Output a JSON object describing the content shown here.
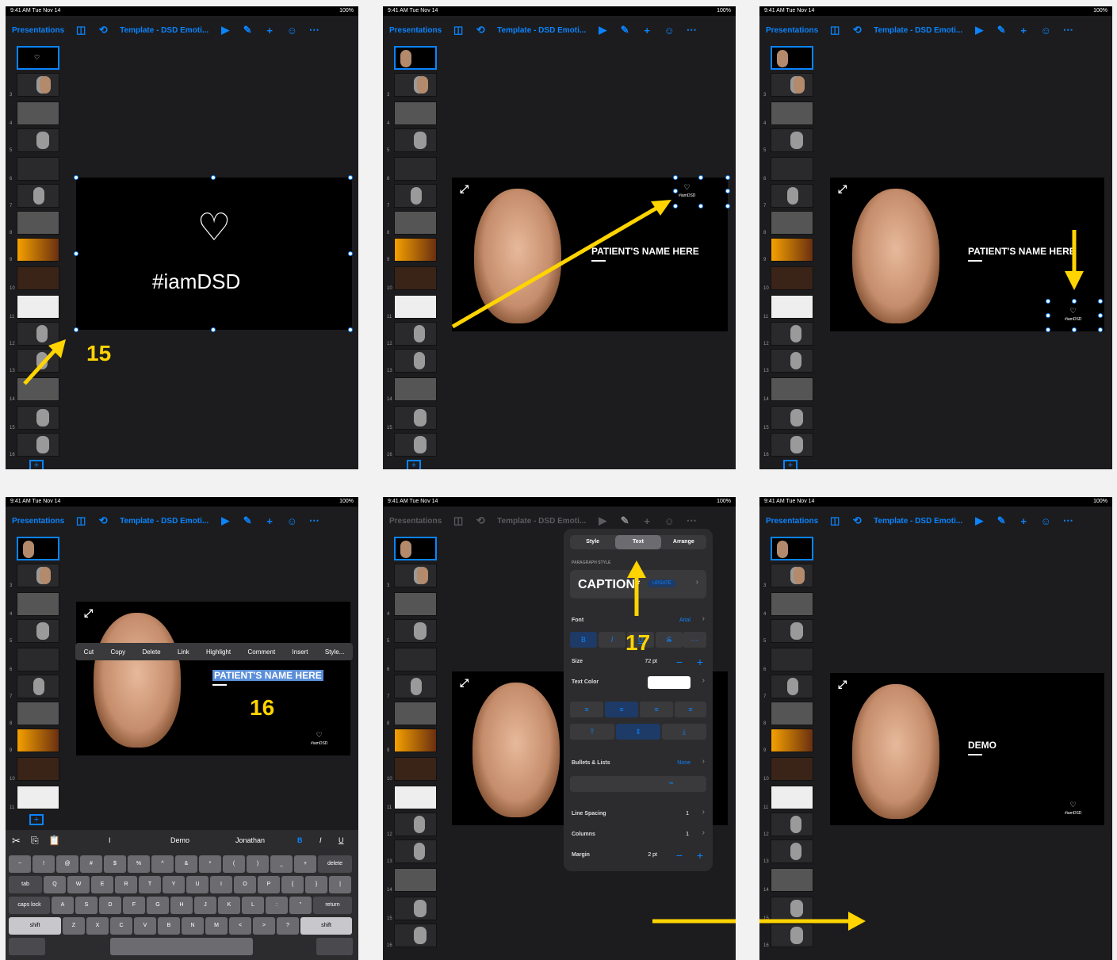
{
  "status": {
    "left": "9:41 AM  Tue Nov 14",
    "right": "100%"
  },
  "toolbar": {
    "presentations": "Presentations",
    "document_title": "Template - DSD Emoti...",
    "icons": [
      "sidebar-icon",
      "undo-icon",
      "play-icon",
      "format-brush-icon",
      "plus-icon",
      "collaborate-icon",
      "more-icon"
    ]
  },
  "slide_numbers": [
    "2",
    "3",
    "4",
    "5",
    "6",
    "7",
    "8",
    "9",
    "10",
    "11",
    "12",
    "13",
    "14",
    "15",
    "16"
  ],
  "panel1": {
    "logo_heart": "♡",
    "logo_text": "#iamDSD",
    "step_number": "15"
  },
  "panel2": {
    "patient_name": "PATIENT'S NAME HERE",
    "logo_text": "#iamDSD"
  },
  "panel3": {
    "patient_name": "PATIENT'S NAME HERE",
    "logo_text": "#iamDSD"
  },
  "panel4": {
    "patient_name": "PATIENT'S NAME HERE",
    "step_number": "16",
    "context_menu": [
      "Cut",
      "Copy",
      "Delete",
      "Link",
      "Highlight",
      "Comment",
      "Insert",
      "Style..."
    ],
    "suggestions": [
      "I",
      "Demo",
      "Jonathan"
    ],
    "format_buttons": [
      "B",
      "I",
      "U"
    ],
    "keyboard": {
      "row1": [
        "~",
        "!",
        "@",
        "#",
        "$",
        "%",
        "^",
        "&",
        "*",
        "(",
        ")",
        "_",
        "+"
      ],
      "row1_end": "delete",
      "row2_start": "tab",
      "row2": [
        "Q",
        "W",
        "E",
        "R",
        "T",
        "Y",
        "U",
        "I",
        "O",
        "P",
        "{",
        "}",
        "|"
      ],
      "row3_start": "caps lock",
      "row3": [
        "A",
        "S",
        "D",
        "F",
        "G",
        "H",
        "J",
        "K",
        "L",
        ":",
        "\""
      ],
      "row3_end": "return",
      "row4_start": "shift",
      "row4": [
        "Z",
        "X",
        "C",
        "V",
        "B",
        "N",
        "M",
        "<",
        ">",
        "?"
      ],
      "row4_end": "shift"
    }
  },
  "panel5": {
    "tabs": [
      "Style",
      "Text",
      "Arrange"
    ],
    "paragraph_style_label": "PARAGRAPH STYLE",
    "paragraph_style": "CAPTION*",
    "update_label": "UPDATE",
    "font_label": "Font",
    "font_value": "Arial",
    "size_label": "Size",
    "size_value": "72 pt",
    "text_color_label": "Text Color",
    "bullets_label": "Bullets & Lists",
    "bullets_value": "None",
    "line_spacing_label": "Line Spacing",
    "line_spacing_value": "1",
    "columns_label": "Columns",
    "columns_value": "1",
    "margin_label": "Margin",
    "margin_value": "2 pt",
    "step_number": "17"
  },
  "panel6": {
    "demo_text": "DEMO",
    "logo_text": "#iamDSD"
  },
  "colors": {
    "accent": "#0a84ff",
    "arrow": "#ffd400",
    "background": "#1c1c1e"
  }
}
